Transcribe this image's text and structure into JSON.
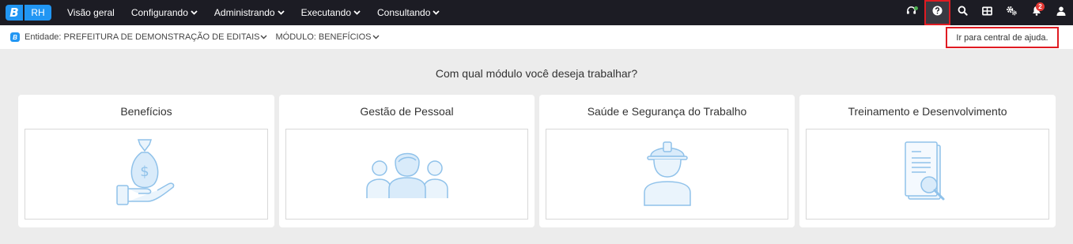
{
  "brand": {
    "logo_letter": "B",
    "module": "RH",
    "accent": "#2196f3"
  },
  "menu": [
    {
      "label": "Visão geral",
      "dropdown": false
    },
    {
      "label": "Configurando",
      "dropdown": true
    },
    {
      "label": "Administrando",
      "dropdown": true
    },
    {
      "label": "Executando",
      "dropdown": true
    },
    {
      "label": "Consultando",
      "dropdown": true
    }
  ],
  "toolbar": {
    "icons": [
      "headset-icon",
      "help-icon",
      "search-icon",
      "apps-grid-icon",
      "settings-icon",
      "notification-bell-icon",
      "user-icon"
    ],
    "notification_count": "2"
  },
  "context": {
    "logo_letter": "B",
    "entity": "Entidade: PREFEITURA DE DEMONSTRAÇÃO DE EDITAIS",
    "module": "MÓDULO: BENEFÍCIOS"
  },
  "tooltip": "Ir para central de ajuda.",
  "main": {
    "question": "Com qual módulo você deseja trabalhar?",
    "cards": [
      {
        "title": "Benefícios",
        "icon": "money-bag-hand-icon"
      },
      {
        "title": "Gestão de Pessoal",
        "icon": "people-group-icon"
      },
      {
        "title": "Saúde e Segurança do Trabalho",
        "icon": "worker-helmet-icon"
      },
      {
        "title": "Treinamento e Desenvolvimento",
        "icon": "document-search-icon"
      }
    ]
  },
  "colors": {
    "topbar": "#1c1c24",
    "highlight": "#e01b22",
    "illustration": "#90c2ea"
  }
}
